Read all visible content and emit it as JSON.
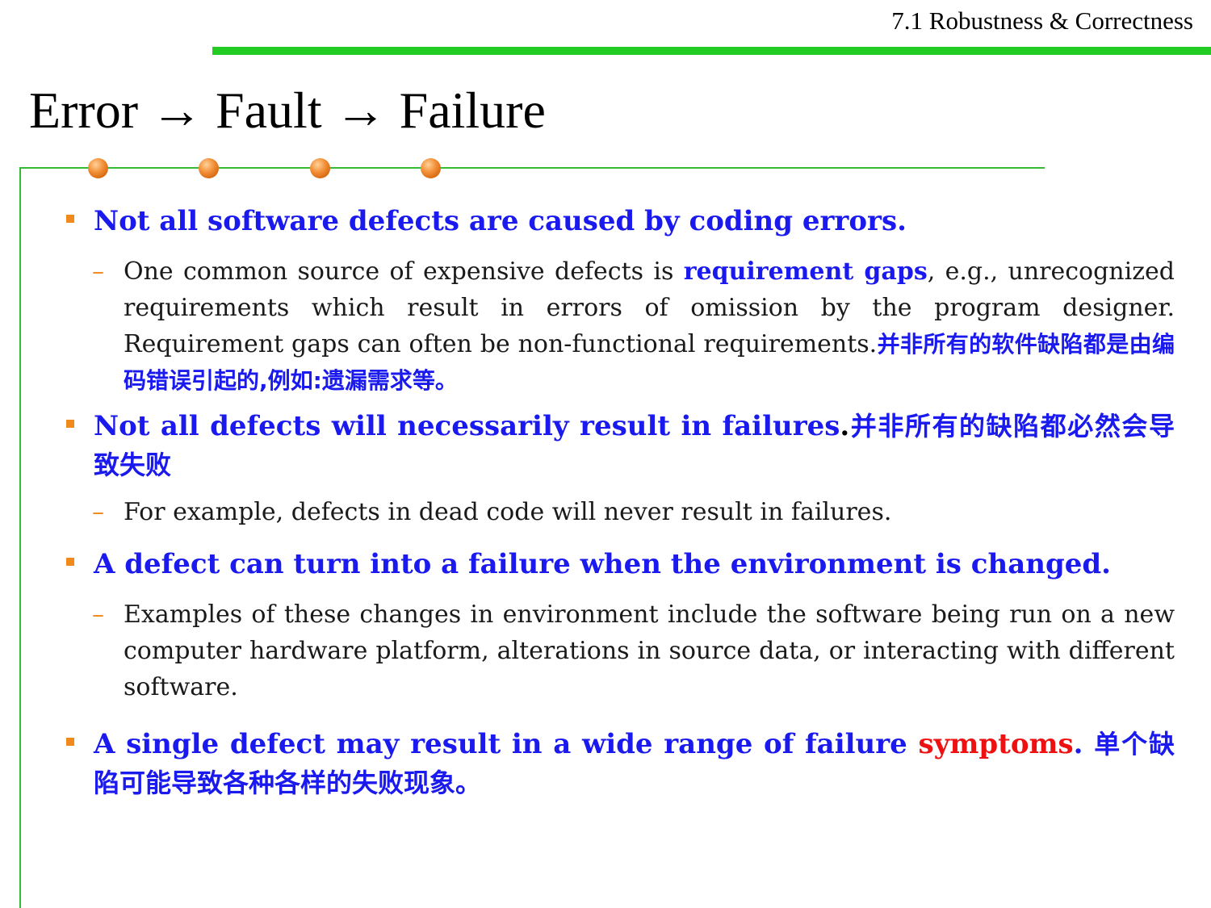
{
  "header": {
    "section": "7.1 Robustness & Correctness",
    "title": "Error → Fault → Failure"
  },
  "colors": {
    "accent_green": "#22cc22",
    "bullet_orange": "#f08a1c",
    "highlight_blue": "#1a1aee",
    "highlight_red": "#ee1111"
  },
  "bullets": [
    {
      "text": "Not all software defects are caused by coding errors.",
      "sub": {
        "before": "One common source of expensive defects is ",
        "highlight": "requirement gaps",
        "after": ", e.g., unrecognized requirements which result in errors of omission by the program designer. Requirement gaps can often be non-functional requirements.",
        "cn": "并非所有的软件缺陷都是由编码错误引起的,例如:遗漏需求等。"
      }
    },
    {
      "text": "Not all defects will necessarily result in failures",
      "punct": ".",
      "cn": "并非所有的缺陷都必然会导致失败",
      "sub": {
        "text": "For example, defects in dead code will never result in failures."
      }
    },
    {
      "text": "A defect can turn into a failure when the environment is changed.",
      "sub": {
        "text": "Examples of these changes in environment include the software being run on a new computer hardware platform, alterations in source data, or interacting with different software."
      }
    },
    {
      "text": "A single defect may result in a wide range of failure ",
      "highlight": "symptoms",
      "punct": ". ",
      "cn": "单个缺陷可能导致各种各样的失败现象。"
    }
  ]
}
